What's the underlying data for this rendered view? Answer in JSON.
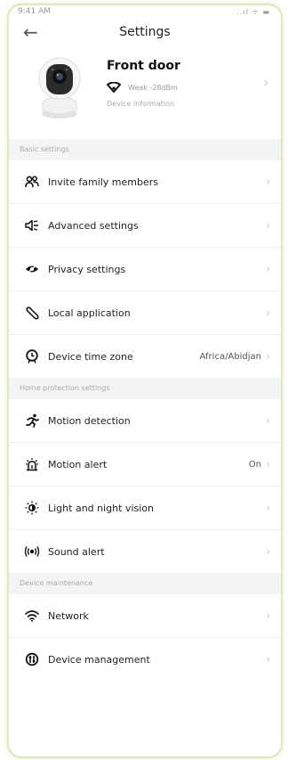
{
  "status_bar": {
    "time": "9:41 AM",
    "signal": "..ıl ᯤ ▬"
  },
  "header": {
    "back_icon": "arrow-left-icon",
    "title": "Settings"
  },
  "device": {
    "name": "Front door",
    "wifi_text": "Weak -28dBm",
    "info_link": "Device information"
  },
  "sections": [
    {
      "title": "Basic settings",
      "items": [
        {
          "label": "Invite family members",
          "icon": "users-icon",
          "value": ""
        },
        {
          "label": "Advanced settings",
          "icon": "speaker-icon",
          "value": ""
        },
        {
          "label": "Privacy settings",
          "icon": "eye-slash-icon",
          "value": ""
        },
        {
          "label": "Local application",
          "icon": "wrench-icon",
          "value": ""
        },
        {
          "label": "Device time zone",
          "icon": "clock-icon",
          "value": "Africa/Abidjan"
        }
      ]
    },
    {
      "title": "Home protection settings",
      "items": [
        {
          "label": "Motion detection",
          "icon": "running-icon",
          "value": ""
        },
        {
          "label": "Motion alert",
          "icon": "alarm-icon",
          "value": "On"
        },
        {
          "label": "Light and night vision",
          "icon": "sun-icon",
          "value": ""
        },
        {
          "label": "Sound alert",
          "icon": "sound-wave-icon",
          "value": ""
        }
      ]
    },
    {
      "title": "Device maintenance",
      "items": [
        {
          "label": "Network",
          "icon": "wifi-icon",
          "value": ""
        },
        {
          "label": "Device management",
          "icon": "device-gear-icon",
          "value": ""
        }
      ]
    }
  ],
  "chevron": "›"
}
